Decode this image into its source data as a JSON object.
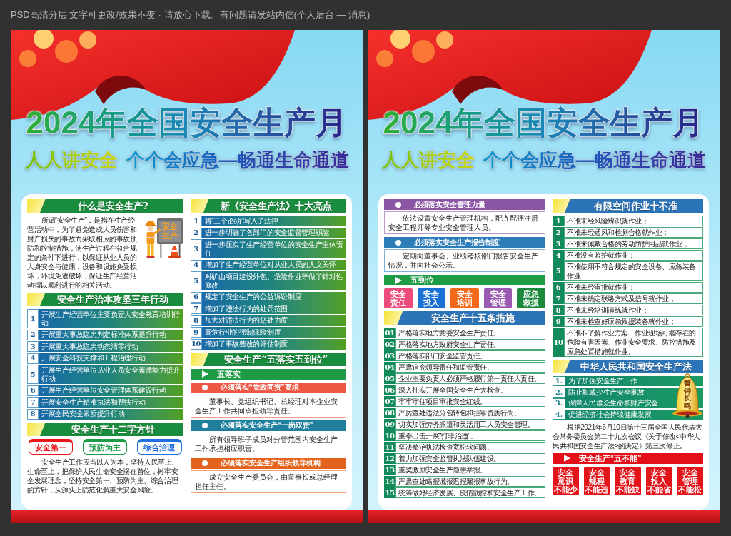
{
  "caption": "PSD高清分层 文字可更改/效果不变 · 请放心下载。有问题请发站内信(个人后台 — 消息)",
  "posters": [
    {
      "title": "2024年全国安全生产月",
      "slogan_left": "人人讲安全",
      "slogan_right": "个个会应急—畅通生命通道",
      "columns": [
        {
          "sections": [
            {
              "kind": "heading",
              "text": "什么是安全生产?",
              "color": "#1a8c3e"
            },
            {
              "kind": "paragraph",
              "sign": "安全生产",
              "text": "所谓“安全生产”，是指在生产经营活动中，为了避免造成人员伤害和财产损失的事故而采取相应的事故预防和控制措施，使生产过程在符合规定的条件下进行，以保证从业人员的人身安全与健康，设备和设施免受损坏，环境免遭破坏，保证生产经营活动得以顺利进行的相关活动。"
            },
            {
              "kind": "heading",
              "text": "安全生产治本攻坚三年行动",
              "color": "#1a8c3e"
            },
            {
              "kind": "gradient_list",
              "items": [
                {
                  "number": "1",
                  "text": "开展生产经营单位主要负责人安全教育培训行动"
                },
                {
                  "number": "2",
                  "text": "开展重大事故隐患判定标准体系提升行动"
                },
                {
                  "number": "3",
                  "text": "开展重大事故隐患动态清零行动"
                },
                {
                  "number": "4",
                  "text": "开展安全科技支撑和工程治理行动"
                },
                {
                  "number": "5",
                  "text": "开展生产经营单位从业人员安全素质能力提升行动"
                },
                {
                  "number": "6",
                  "text": "开展生产经营单位安全管理体系建设行动"
                },
                {
                  "number": "7",
                  "text": "开展安全生产精准执法和帮扶行动"
                },
                {
                  "number": "8",
                  "text": "开展全民安全素质提升行动"
                }
              ]
            },
            {
              "kind": "heading",
              "text": "安全生产十二字方针",
              "color": "#1a8c3e"
            },
            {
              "kind": "tags",
              "items": [
                {
                  "text": "安全第一",
                  "color": "#e8161b"
                },
                {
                  "text": "预防为主",
                  "color": "#1d9a48"
                },
                {
                  "text": "综合治理",
                  "color": "#1f6fe0"
                }
              ]
            },
            {
              "kind": "paragraph",
              "text": "安全生产工作应当以人为本，坚持人民至上、生命至上，把保护人民生命安全摆在首位，树牢安全发展理念，坚持安全第一、预防为主、综合治理的方针，从源头上防范化解重大安全风险。"
            }
          ]
        },
        {
          "sections": [
            {
              "kind": "heading",
              "text": "新《安全生产法》十大亮点",
              "color": "#1a8c3e"
            },
            {
              "kind": "gradient_list",
              "items": [
                {
                  "number": "1",
                  "text": "将“三个必须”写入了法律"
                },
                {
                  "number": "2",
                  "text": "进一步明确了各部门的安全监督管理职能"
                },
                {
                  "number": "3",
                  "text": "进一步压实了生产经营单位的安全生产主体责任"
                },
                {
                  "number": "4",
                  "text": "增加了生产经营单位对从业人员的人文关怀"
                },
                {
                  "number": "5",
                  "text": "对矿山项目建设外包、危险作业等做了针对性修改"
                },
                {
                  "number": "6",
                  "text": "规定了安全生产的公益诉讼制度"
                },
                {
                  "number": "7",
                  "text": "增加了违法行为的处罚范围"
                },
                {
                  "number": "8",
                  "text": "加大对违法行为的惩处力度"
                },
                {
                  "number": "9",
                  "text": "高危行业的强制保险制度"
                },
                {
                  "number": "10",
                  "text": "增加了事故整改的评估制度"
                }
              ]
            },
            {
              "kind": "heading",
              "text": "安全生产“五落实五到位”",
              "color": "#1a8c3e"
            },
            {
              "kind": "bar",
              "text": "五落实",
              "color": "#1f9a45"
            },
            {
              "kind": "notice",
              "title": "必须落实“党政同责”要求",
              "body": "董事长、党组织书记、总经理对本企业安全生产工作共同承担领导责任。",
              "color": "#ee5744"
            },
            {
              "kind": "notice",
              "title": "必须落实安全生产“一岗双责”",
              "body": "所有领导班子成员对分管范围内安全生产工作承担相应职责。",
              "color": "#1f7f9c"
            },
            {
              "kind": "notice",
              "title": "必须落实安全生产组织领导机构",
              "body": "成立安全生产委员会，由董事长或总经理担任主任。",
              "color": "#e3621d"
            }
          ]
        }
      ]
    },
    {
      "title": "2024年全国安全生产月",
      "slogan_left": "人人讲安全",
      "slogan_right": "个个会应急—畅通生命通道",
      "columns": [
        {
          "sections": [
            {
              "kind": "notice",
              "title": "必须落实安全管理力量",
              "body": "依法设置安全生产管理机构，配齐配强注册安全工程师等专业安全管理人员。",
              "color": "#8b56a6"
            },
            {
              "kind": "notice",
              "title": "必须落实安全生产报告制度",
              "body": "定期向董事会、业绩考核部门报告安全生产情况，并向社会公示。",
              "color": "#2c7cb8"
            },
            {
              "kind": "bar",
              "text": "五到位",
              "color": "#1f9a45"
            },
            {
              "kind": "tiles",
              "items": [
                {
                  "lines": [
                    "安全",
                    "责任"
                  ],
                  "color": "#ec4c7c"
                },
                {
                  "lines": [
                    "安全",
                    "投入"
                  ],
                  "color": "#1b72d6"
                },
                {
                  "lines": [
                    "安全",
                    "培训"
                  ],
                  "color": "#f2691a"
                },
                {
                  "lines": [
                    "安全",
                    "管理"
                  ],
                  "color": "#9a5ab0"
                },
                {
                  "lines": [
                    "应急",
                    "救援"
                  ],
                  "color": "#1b8a3c"
                }
              ]
            },
            {
              "kind": "heading",
              "text": "安全生产十五条措施",
              "color": "#2b74b8"
            },
            {
              "kind": "boxed_list",
              "items": [
                {
                  "number": "01",
                  "text": "严格落实地方党委安全生产责任。"
                },
                {
                  "number": "02",
                  "text": "严格落实地方政府安全生产责任。"
                },
                {
                  "number": "03",
                  "text": "严格落实部门安全监管责任。"
                },
                {
                  "number": "04",
                  "text": "严肃追究领导责任和监管责任。"
                },
                {
                  "number": "05",
                  "text": "企业主要负责人必须严格履行第一责任人责任。"
                },
                {
                  "number": "06",
                  "text": "深入扎实开展全国安全生产大检查。"
                },
                {
                  "number": "07",
                  "text": "牢牢守住项目审批安全红线。"
                },
                {
                  "number": "08",
                  "text": "严厉查处违法分包转包和挂靠资质行为。"
                },
                {
                  "number": "09",
                  "text": "切实加强劳务派遣和灵活用工人员安全管理。"
                },
                {
                  "number": "10",
                  "text": "重拳出击开展“打非治违”。"
                },
                {
                  "number": "11",
                  "text": "坚决整治执法检查宽松软问题。"
                },
                {
                  "number": "12",
                  "text": "着力加强安全监管执法队伍建设。"
                },
                {
                  "number": "13",
                  "text": "重奖激励安全生产隐患举报。"
                },
                {
                  "number": "14",
                  "text": "严肃查处瞒报谎报迟报漏报事故行为。"
                },
                {
                  "number": "15",
                  "text": "统筹做好经济发展、疫情防控和安全生产工作。"
                }
              ]
            }
          ]
        },
        {
          "sections": [
            {
              "kind": "heading",
              "text": "有限空间作业十不准",
              "color": "#2b74b8"
            },
            {
              "kind": "boxed_list",
              "items": [
                {
                  "number": "1",
                  "text": "不准未经风险辨识就作业；"
                },
                {
                  "number": "2",
                  "text": "不准未经通风和检测合格就作业；"
                },
                {
                  "number": "3",
                  "text": "不准未佩戴合格的劳动防护用品就作业；"
                },
                {
                  "number": "4",
                  "text": "不准没有监护就作业；"
                },
                {
                  "number": "5",
                  "text": "不准使用不符合规定的安全设备、应急装备作业"
                },
                {
                  "number": "6",
                  "text": "不准未经审批就作业；"
                },
                {
                  "number": "7",
                  "text": "不准未确定联络方式及信号就作业；"
                },
                {
                  "number": "8",
                  "text": "不准未经培训演练就作业；"
                },
                {
                  "number": "9",
                  "text": "不准未检查好应急救援装备就作业；"
                },
                {
                  "number": "10",
                  "text": "不准不了解作业方案、作业现场可能存在的危险有害因素、作业安全要求、防控措施及应急处置措施就作业。"
                }
              ]
            },
            {
              "kind": "heading",
              "text": "中华人民共和国安全生产法",
              "color": "#2b74b8"
            },
            {
              "kind": "teal_list",
              "bell_text": "警钟长鸣",
              "items": [
                {
                  "number": "1.",
                  "text": "为了加强安全生产工作"
                },
                {
                  "number": "2.",
                  "text": "防止和减少生产安全事故"
                },
                {
                  "number": "3.",
                  "text": "保障人民群众生命和财产安全"
                },
                {
                  "number": "4.",
                  "text": "促进经济社会持续健康发展"
                }
              ]
            },
            {
              "kind": "paragraph",
              "text": "根据2021年6月10日第十三届全国人民代表大会常务委员会第二十九次会议《关于修改<中华人民共和国安全生产法>的决定》第三次修正。"
            },
            {
              "kind": "bar",
              "text": "安全生产“五不能”",
              "color": "#e3101a"
            },
            {
              "kind": "tiles",
              "items": [
                {
                  "lines": [
                    "安全",
                    "意识",
                    "不能少"
                  ],
                  "color": "#e3151b"
                },
                {
                  "lines": [
                    "安全",
                    "规程",
                    "不能违"
                  ],
                  "color": "#e3151b"
                },
                {
                  "lines": [
                    "安全",
                    "教育",
                    "不能缺"
                  ],
                  "color": "#e3151b"
                },
                {
                  "lines": [
                    "安全",
                    "投入",
                    "不能省"
                  ],
                  "color": "#e3151b"
                },
                {
                  "lines": [
                    "安全",
                    "管理",
                    "不能松"
                  ],
                  "color": "#e3151b"
                }
              ]
            }
          ]
        }
      ]
    }
  ]
}
